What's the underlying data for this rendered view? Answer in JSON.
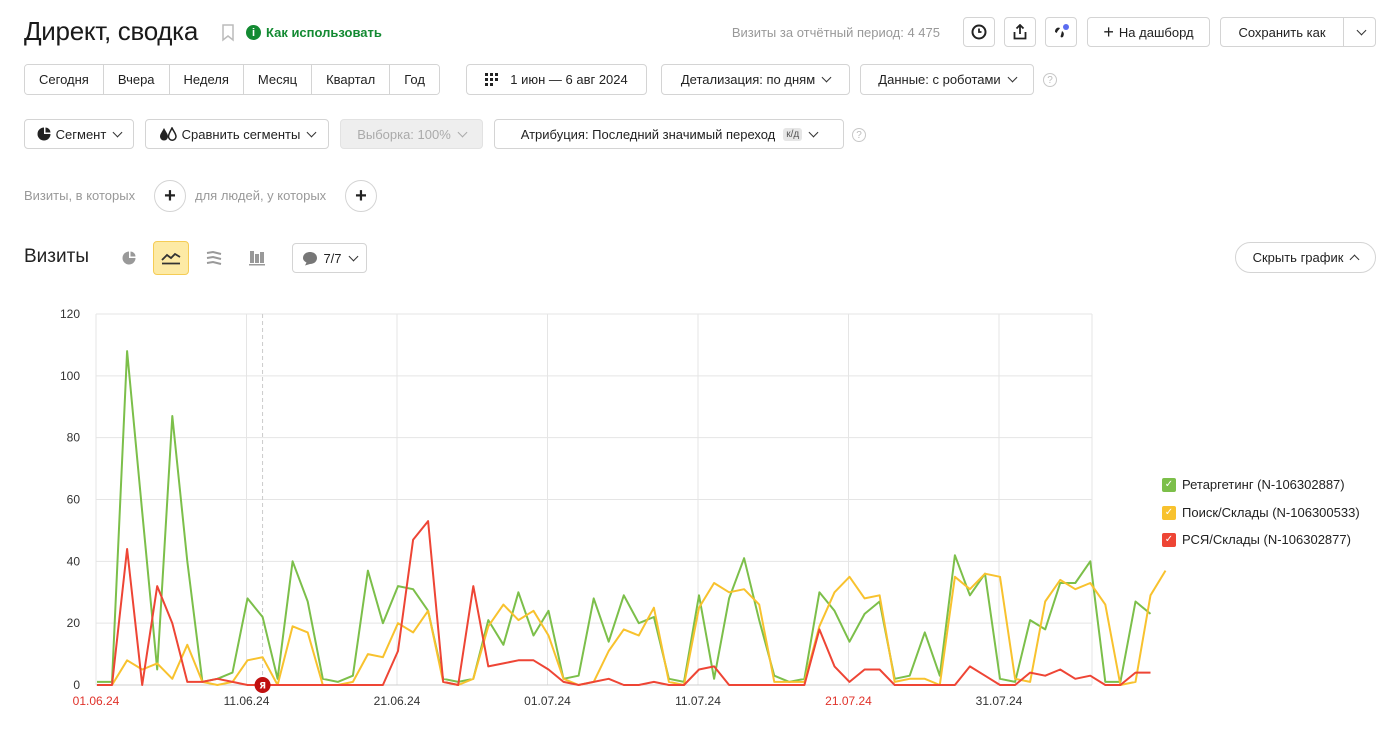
{
  "header": {
    "title": "Директ, сводка",
    "howto_label": "Как использовать",
    "visits_total": "Визиты за отчётный период: 4 475",
    "dashboard_label": "На дашборд",
    "save_as_label": "Сохранить как"
  },
  "periods": [
    "Сегодня",
    "Вчера",
    "Неделя",
    "Месяц",
    "Квартал",
    "Год"
  ],
  "date_range": "1 июн — 6 авг 2024",
  "detail_label": "Детализация: по дням",
  "data_label": "Данные: с роботами",
  "segment_label": "Сегмент",
  "compare_label": "Сравнить сегменты",
  "sample_label": "Выборка: 100%",
  "attribution_label": "Атрибуция: Последний значимый переход",
  "attribution_badge": "к/д",
  "filters": {
    "visits_text": "Визиты, в которых",
    "people_text": "для людей, у которых"
  },
  "section": {
    "title": "Визиты",
    "annotations_count": "7/7",
    "hide_chart_label": "Скрыть график"
  },
  "colors": {
    "retargeting": "#7cbf4a",
    "search": "#f8c22e",
    "rsya": "#ee4535",
    "weekend_label": "#e0322a",
    "accent_green": "#138a32"
  },
  "chart_data": {
    "type": "line",
    "x_start": "01.06.24",
    "x_ticks": [
      "01.06.24",
      "11.06.24",
      "21.06.24",
      "01.07.24",
      "11.07.24",
      "21.07.24",
      "31.07.24"
    ],
    "x_ticks_weekend": [
      "01.06.24",
      "21.07.24"
    ],
    "ylim": [
      0,
      120
    ],
    "yticks": [
      0,
      20,
      40,
      60,
      80,
      100,
      120
    ],
    "grid": true,
    "legend": "right",
    "annotation_marker": {
      "date": "12.06.24",
      "label": "Я"
    },
    "series": [
      {
        "name": "Ретаргетинг (N-106302887)",
        "color": "#7cbf4a",
        "values": [
          1,
          1,
          108,
          56,
          5,
          87,
          40,
          1,
          2,
          4,
          28,
          22,
          2,
          40,
          27,
          2,
          1,
          3,
          37,
          20,
          32,
          31,
          24,
          2,
          1,
          2,
          21,
          13,
          30,
          16,
          24,
          2,
          3,
          28,
          14,
          29,
          20,
          22,
          2,
          1,
          29,
          2,
          28,
          41,
          21,
          3,
          1,
          2,
          30,
          24,
          14,
          23,
          27,
          2,
          3,
          17,
          3,
          42,
          29,
          36,
          2,
          1,
          21,
          18,
          33,
          33,
          40,
          1,
          1,
          27,
          23
        ]
      },
      {
        "name": "Поиск/Склады (N-106300533)",
        "color": "#f8c22e",
        "values": [
          0,
          0,
          8,
          5,
          7,
          2,
          13,
          1,
          0,
          1,
          8,
          9,
          0,
          19,
          17,
          0,
          0,
          1,
          10,
          9,
          20,
          17,
          24,
          1,
          0,
          2,
          19,
          26,
          21,
          24,
          16,
          2,
          0,
          1,
          11,
          18,
          16,
          25,
          1,
          0,
          25,
          33,
          30,
          31,
          26,
          1,
          1,
          1,
          19,
          30,
          35,
          28,
          29,
          1,
          2,
          2,
          0,
          35,
          31,
          36,
          35,
          2,
          1,
          27,
          34,
          31,
          33,
          26,
          0,
          1,
          29,
          37
        ]
      },
      {
        "name": "РСЯ/Склады (N-106302877)",
        "color": "#ee4535",
        "values": [
          0,
          0,
          44,
          0,
          32,
          20,
          1,
          1,
          2,
          1,
          0,
          0,
          0,
          0,
          0,
          0,
          0,
          0,
          0,
          0,
          11,
          47,
          53,
          1,
          0,
          32,
          6,
          7,
          8,
          8,
          5,
          1,
          0,
          1,
          2,
          0,
          0,
          1,
          0,
          0,
          5,
          6,
          0,
          0,
          0,
          0,
          0,
          0,
          18,
          6,
          1,
          5,
          5,
          0,
          0,
          0,
          0,
          0,
          6,
          3,
          0,
          0,
          4,
          3,
          5,
          2,
          3,
          0,
          0,
          4,
          4
        ]
      }
    ]
  }
}
